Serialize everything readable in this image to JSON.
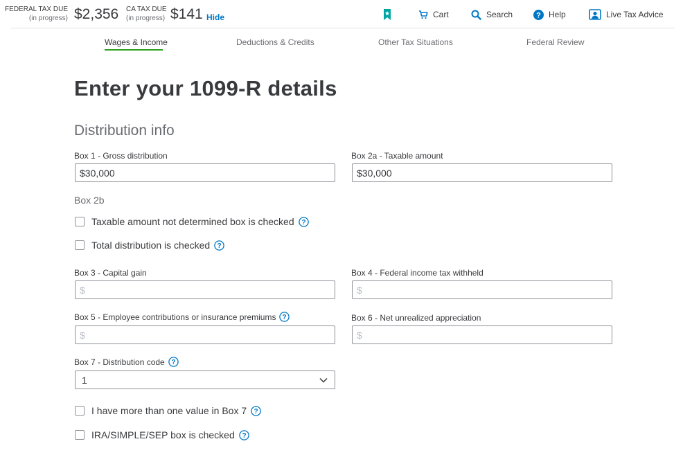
{
  "header": {
    "federal": {
      "label": "FEDERAL TAX DUE",
      "status": "(in progress)",
      "amount": "$2,356"
    },
    "state": {
      "label": "CA TAX DUE",
      "status": "(in progress)",
      "amount": "$141"
    },
    "hide_label": "Hide",
    "nav": {
      "cart": "Cart",
      "search": "Search",
      "help": "Help",
      "live_advice": "Live Tax Advice"
    }
  },
  "tabs": [
    {
      "label": "Wages & Income"
    },
    {
      "label": "Deductions & Credits"
    },
    {
      "label": "Other Tax Situations"
    },
    {
      "label": "Federal Review"
    }
  ],
  "page": {
    "title": "Enter your 1099-R details",
    "section": "Distribution info"
  },
  "fields": {
    "box1": {
      "label": "Box 1 - Gross distribution",
      "value": "$30,000"
    },
    "box2a": {
      "label": "Box 2a - Taxable amount",
      "value": "$30,000"
    },
    "box2b": {
      "label": "Box 2b",
      "taxable_not_determined": "Taxable amount not determined box is checked",
      "total_distribution": "Total distribution is checked"
    },
    "box3": {
      "label": "Box 3 - Capital gain",
      "placeholder": "$"
    },
    "box4": {
      "label": "Box 4 - Federal income tax withheld",
      "placeholder": "$"
    },
    "box5": {
      "label": "Box 5 - Employee contributions or insurance premiums",
      "placeholder": "$"
    },
    "box6": {
      "label": "Box 6 - Net unrealized appreciation",
      "placeholder": "$"
    },
    "box7": {
      "label": "Box 7 - Distribution code",
      "value": "1"
    },
    "more_than_one": "I have more than one value in Box 7",
    "ira_sep": "IRA/SIMPLE/SEP box is checked"
  },
  "colors": {
    "accent": "#0077c5",
    "tab_underline": "#2ca01c",
    "bookmark": "#00a6a4"
  }
}
